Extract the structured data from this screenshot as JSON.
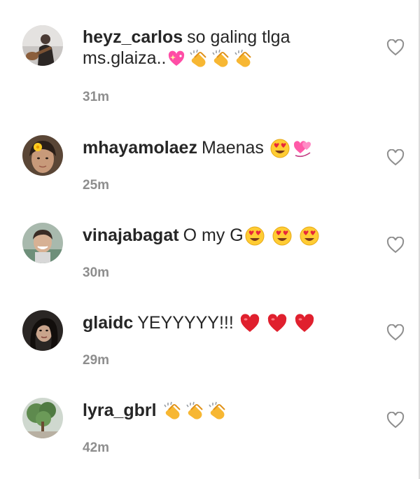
{
  "comments": [
    {
      "username": "heyz_carlos",
      "text": "so galing tlga ms.glaiza..",
      "emojis": [
        "sparkling-heart",
        "clap",
        "clap",
        "clap"
      ],
      "time": "31m",
      "avatar": "guitar-player-avatar"
    },
    {
      "username": "mhayamolaez",
      "text": "Maenas",
      "emojis": [
        "heart-eyes",
        "revolving-hearts"
      ],
      "time": "25m",
      "avatar": "woman-flower-avatar"
    },
    {
      "username": "vinajabagat",
      "text": "O my G",
      "emojis": [
        "heart-eyes",
        "heart-eyes",
        "heart-eyes"
      ],
      "time": "30m",
      "avatar": "smiling-person-avatar"
    },
    {
      "username": "glaidc",
      "text": "YEYYYYY!!!",
      "emojis": [
        "red-heart",
        "red-heart",
        "red-heart"
      ],
      "time": "29m",
      "avatar": "dark-hair-avatar"
    },
    {
      "username": "lyra_gbrl",
      "text": "",
      "emojis": [
        "clap",
        "clap",
        "clap"
      ],
      "time": "42m",
      "avatar": "tree-avatar"
    }
  ],
  "colors": {
    "text": "#262626",
    "muted": "#8e8e8e",
    "heart_outline": "#8e8e8e"
  }
}
